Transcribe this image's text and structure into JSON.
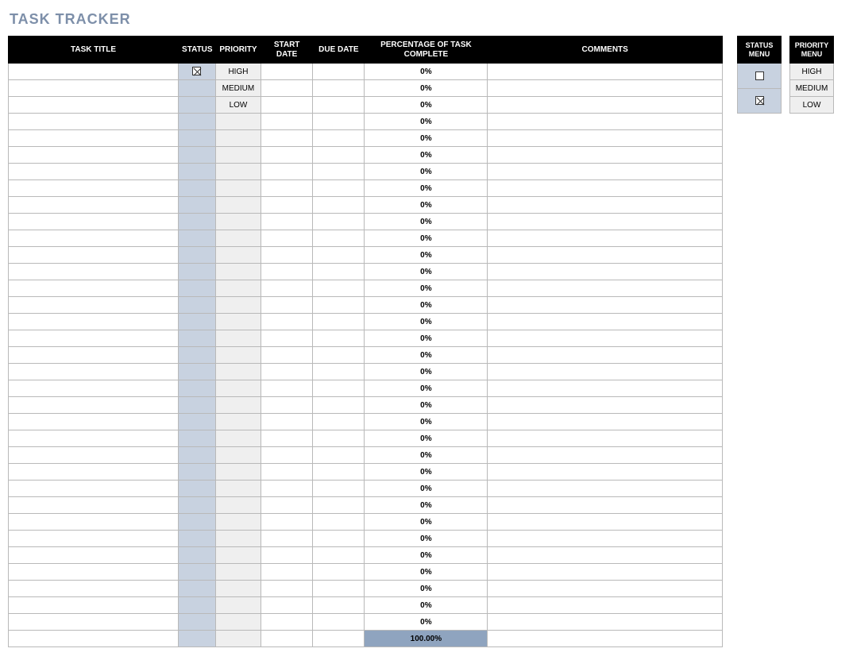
{
  "title": "TASK TRACKER",
  "columns": {
    "task_title": "TASK TITLE",
    "status": "STATUS",
    "priority": "PRIORITY",
    "start_date": "START DATE",
    "due_date": "DUE DATE",
    "percent": "PERCENTAGE OF TASK COMPLETE",
    "comments": "COMMENTS"
  },
  "rows": [
    {
      "task_title": "",
      "status_checked": true,
      "priority": "HIGH",
      "start_date": "",
      "due_date": "",
      "percent": "0%",
      "comments": ""
    },
    {
      "task_title": "",
      "status_checked": false,
      "priority": "MEDIUM",
      "start_date": "",
      "due_date": "",
      "percent": "0%",
      "comments": ""
    },
    {
      "task_title": "",
      "status_checked": false,
      "priority": "LOW",
      "start_date": "",
      "due_date": "",
      "percent": "0%",
      "comments": ""
    },
    {
      "task_title": "",
      "status_checked": false,
      "priority": "",
      "start_date": "",
      "due_date": "",
      "percent": "0%",
      "comments": ""
    },
    {
      "task_title": "",
      "status_checked": false,
      "priority": "",
      "start_date": "",
      "due_date": "",
      "percent": "0%",
      "comments": ""
    },
    {
      "task_title": "",
      "status_checked": false,
      "priority": "",
      "start_date": "",
      "due_date": "",
      "percent": "0%",
      "comments": ""
    },
    {
      "task_title": "",
      "status_checked": false,
      "priority": "",
      "start_date": "",
      "due_date": "",
      "percent": "0%",
      "comments": ""
    },
    {
      "task_title": "",
      "status_checked": false,
      "priority": "",
      "start_date": "",
      "due_date": "",
      "percent": "0%",
      "comments": ""
    },
    {
      "task_title": "",
      "status_checked": false,
      "priority": "",
      "start_date": "",
      "due_date": "",
      "percent": "0%",
      "comments": ""
    },
    {
      "task_title": "",
      "status_checked": false,
      "priority": "",
      "start_date": "",
      "due_date": "",
      "percent": "0%",
      "comments": ""
    },
    {
      "task_title": "",
      "status_checked": false,
      "priority": "",
      "start_date": "",
      "due_date": "",
      "percent": "0%",
      "comments": ""
    },
    {
      "task_title": "",
      "status_checked": false,
      "priority": "",
      "start_date": "",
      "due_date": "",
      "percent": "0%",
      "comments": ""
    },
    {
      "task_title": "",
      "status_checked": false,
      "priority": "",
      "start_date": "",
      "due_date": "",
      "percent": "0%",
      "comments": ""
    },
    {
      "task_title": "",
      "status_checked": false,
      "priority": "",
      "start_date": "",
      "due_date": "",
      "percent": "0%",
      "comments": ""
    },
    {
      "task_title": "",
      "status_checked": false,
      "priority": "",
      "start_date": "",
      "due_date": "",
      "percent": "0%",
      "comments": ""
    },
    {
      "task_title": "",
      "status_checked": false,
      "priority": "",
      "start_date": "",
      "due_date": "",
      "percent": "0%",
      "comments": ""
    },
    {
      "task_title": "",
      "status_checked": false,
      "priority": "",
      "start_date": "",
      "due_date": "",
      "percent": "0%",
      "comments": ""
    },
    {
      "task_title": "",
      "status_checked": false,
      "priority": "",
      "start_date": "",
      "due_date": "",
      "percent": "0%",
      "comments": ""
    },
    {
      "task_title": "",
      "status_checked": false,
      "priority": "",
      "start_date": "",
      "due_date": "",
      "percent": "0%",
      "comments": ""
    },
    {
      "task_title": "",
      "status_checked": false,
      "priority": "",
      "start_date": "",
      "due_date": "",
      "percent": "0%",
      "comments": ""
    },
    {
      "task_title": "",
      "status_checked": false,
      "priority": "",
      "start_date": "",
      "due_date": "",
      "percent": "0%",
      "comments": ""
    },
    {
      "task_title": "",
      "status_checked": false,
      "priority": "",
      "start_date": "",
      "due_date": "",
      "percent": "0%",
      "comments": ""
    },
    {
      "task_title": "",
      "status_checked": false,
      "priority": "",
      "start_date": "",
      "due_date": "",
      "percent": "0%",
      "comments": ""
    },
    {
      "task_title": "",
      "status_checked": false,
      "priority": "",
      "start_date": "",
      "due_date": "",
      "percent": "0%",
      "comments": ""
    },
    {
      "task_title": "",
      "status_checked": false,
      "priority": "",
      "start_date": "",
      "due_date": "",
      "percent": "0%",
      "comments": ""
    },
    {
      "task_title": "",
      "status_checked": false,
      "priority": "",
      "start_date": "",
      "due_date": "",
      "percent": "0%",
      "comments": ""
    },
    {
      "task_title": "",
      "status_checked": false,
      "priority": "",
      "start_date": "",
      "due_date": "",
      "percent": "0%",
      "comments": ""
    },
    {
      "task_title": "",
      "status_checked": false,
      "priority": "",
      "start_date": "",
      "due_date": "",
      "percent": "0%",
      "comments": ""
    },
    {
      "task_title": "",
      "status_checked": false,
      "priority": "",
      "start_date": "",
      "due_date": "",
      "percent": "0%",
      "comments": ""
    },
    {
      "task_title": "",
      "status_checked": false,
      "priority": "",
      "start_date": "",
      "due_date": "",
      "percent": "0%",
      "comments": ""
    },
    {
      "task_title": "",
      "status_checked": false,
      "priority": "",
      "start_date": "",
      "due_date": "",
      "percent": "0%",
      "comments": ""
    },
    {
      "task_title": "",
      "status_checked": false,
      "priority": "",
      "start_date": "",
      "due_date": "",
      "percent": "0%",
      "comments": ""
    },
    {
      "task_title": "",
      "status_checked": false,
      "priority": "",
      "start_date": "",
      "due_date": "",
      "percent": "0%",
      "comments": ""
    },
    {
      "task_title": "",
      "status_checked": false,
      "priority": "",
      "start_date": "",
      "due_date": "",
      "percent": "0%",
      "comments": ""
    }
  ],
  "total_percent": "100.00%",
  "status_menu": {
    "header": "STATUS MENU",
    "items": [
      {
        "checked": false
      },
      {
        "checked": true
      }
    ]
  },
  "priority_menu": {
    "header": "PRIORITY MENU",
    "items": [
      "HIGH",
      "MEDIUM",
      "LOW"
    ]
  }
}
